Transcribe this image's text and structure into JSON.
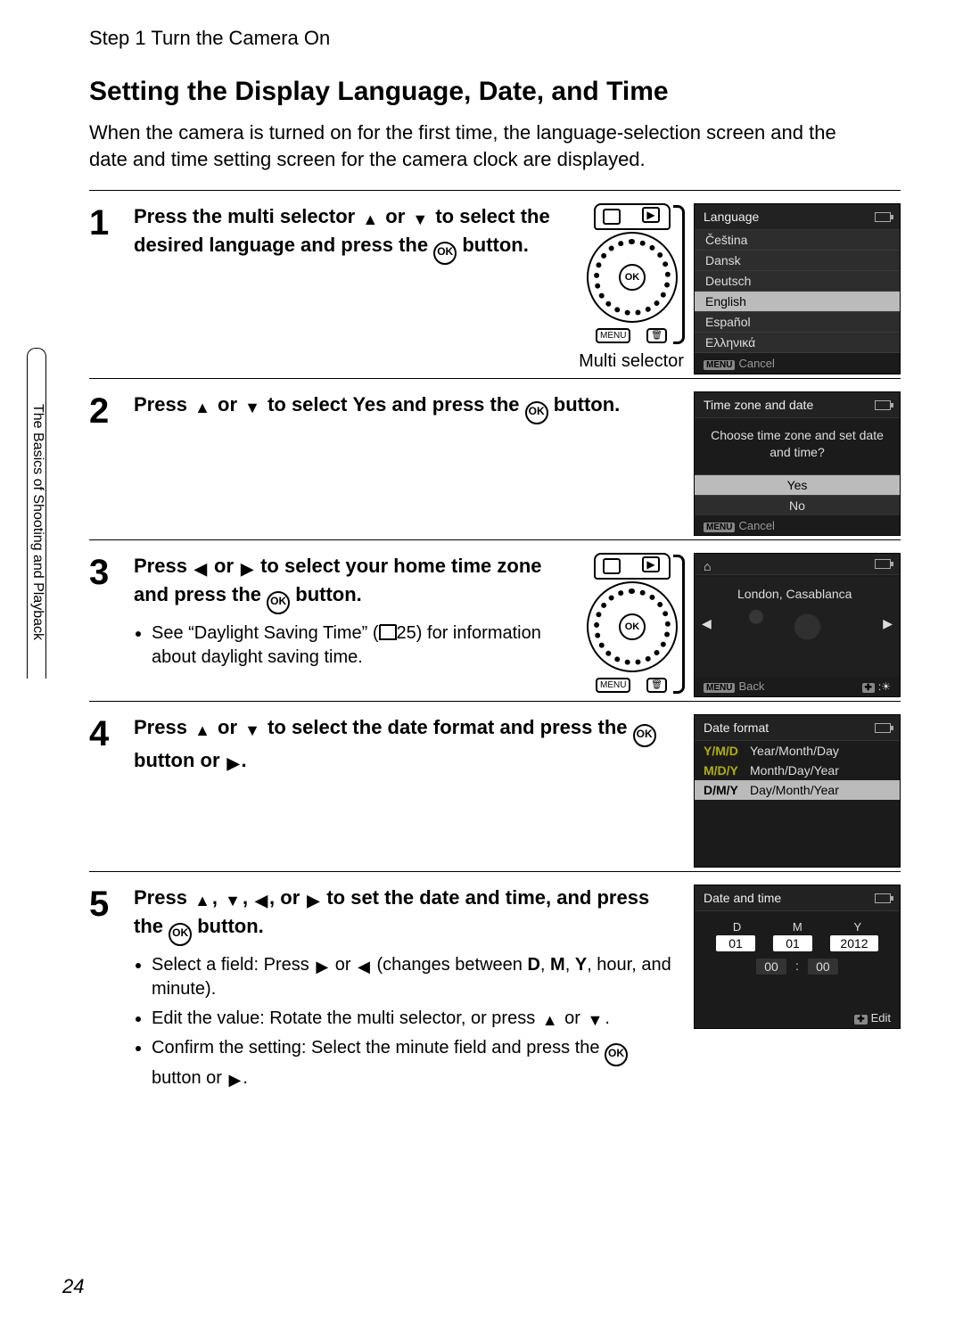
{
  "page": {
    "running_head": "Step 1 Turn the Camera On",
    "title": "Setting the Display Language, Date, and Time",
    "intro": "When the camera is turned on for the first time, the language-selection screen and the date and time setting screen for the camera clock are displayed.",
    "side_tab": "The Basics of Shooting and Playback",
    "page_number": "24"
  },
  "ico": {
    "up": "▲",
    "down": "▼",
    "left": "◀",
    "right": "▶",
    "ok": "OK"
  },
  "step1": {
    "n": "1",
    "text_a": "Press the multi selector ",
    "text_b": " or ",
    "text_c": " to select the desired language and press the ",
    "text_d": " button.",
    "caption": "Multi selector",
    "lcd": {
      "title": "Language",
      "items": [
        "Čeština",
        "Dansk",
        "Deutsch",
        "English",
        "Español",
        "Ελληνικά"
      ],
      "sel_index": 3,
      "cancel": "Cancel"
    }
  },
  "step2": {
    "n": "2",
    "text_a": "Press ",
    "text_b": " or ",
    "text_c": " to select ",
    "yes": "Yes",
    "text_d": " and press the ",
    "text_e": " button.",
    "lcd": {
      "title": "Time zone and date",
      "question": "Choose time zone and set date and time?",
      "yes": "Yes",
      "no": "No",
      "cancel": "Cancel"
    }
  },
  "step3": {
    "n": "3",
    "text_a": "Press ",
    "text_b": " or ",
    "text_c": " to select your home time zone and press the ",
    "text_d": " button.",
    "bullet_a": "See “Daylight Saving Time” (",
    "bullet_pageref": "25",
    "bullet_b": ") for information about daylight saving time.",
    "lcd": {
      "city": "London, Casablanca",
      "back": "Back"
    }
  },
  "step4": {
    "n": "4",
    "text_a": "Press ",
    "text_b": " or ",
    "text_c": " to select the date format and press the ",
    "text_d": " button or ",
    "text_e": ".",
    "lcd": {
      "title": "Date format",
      "rows": [
        {
          "code": "Y/M/D",
          "label": "Year/Month/Day"
        },
        {
          "code": "M/D/Y",
          "label": "Month/Day/Year"
        },
        {
          "code": "D/M/Y",
          "label": "Day/Month/Year"
        }
      ],
      "sel_index": 2
    }
  },
  "step5": {
    "n": "5",
    "text_a": "Press ",
    "comma": ", ",
    "text_b": ", or ",
    "text_c": " to set the date and time, and press the ",
    "text_d": " button.",
    "b1_a": "Select a field: Press ",
    "b1_b": " or ",
    "b1_c": " (changes between ",
    "b1_D": "D",
    "b1_M": "M",
    "b1_Y": "Y",
    "b1_d": ", hour, and minute).",
    "b2_a": "Edit the value: Rotate the multi selector, or press ",
    "b2_b": " or ",
    "b2_c": ".",
    "b3_a": "Confirm the setting: Select the minute field and press the ",
    "b3_b": " button or ",
    "b3_c": ".",
    "lcd": {
      "title": "Date and time",
      "labels": [
        "D",
        "M",
        "Y"
      ],
      "date": [
        "01",
        "01",
        "2012"
      ],
      "time": [
        "00",
        "00"
      ],
      "edit": "Edit"
    }
  }
}
